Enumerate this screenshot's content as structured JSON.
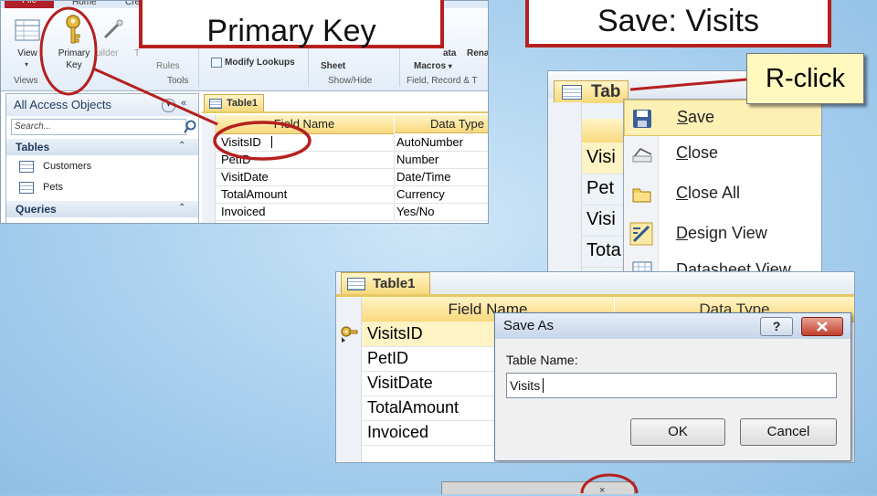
{
  "ribbon": {
    "file_tab": "File",
    "home_tab": "Home",
    "create_tab": "Cre",
    "view_label": "View",
    "primary_key_line1": "Primary",
    "primary_key_line2": "Key",
    "builder_label": "uilder",
    "test_label": "T",
    "rules_label": "Rules",
    "modify_lookups_label": "Modify Lookups",
    "sheet_label": "Sheet",
    "data_label": "ata",
    "rename_label": "Rena",
    "macros_label": "Macros",
    "group_views": "Views",
    "group_tools": "Tools",
    "group_show_hide": "Show/Hide",
    "group_field_record": "Field, Record & T"
  },
  "nav_pane": {
    "title": "All Access Objects",
    "search_placeholder": "Search...",
    "groups": [
      {
        "label": "Tables",
        "items": [
          "Customers",
          "Pets"
        ]
      },
      {
        "label": "Queries",
        "items": []
      }
    ]
  },
  "design_view": {
    "tab_label": "Table1",
    "col_field_name": "Field Name",
    "col_data_type": "Data Type",
    "rows": [
      {
        "field": "VisitsID",
        "type": "AutoNumber"
      },
      {
        "field": "PetID",
        "type": "Number"
      },
      {
        "field": "VisitDate",
        "type": "Date/Time"
      },
      {
        "field": "TotalAmount",
        "type": "Currency"
      },
      {
        "field": "Invoiced",
        "type": "Yes/No"
      }
    ]
  },
  "callouts": {
    "primary_key": "Primary Key",
    "save_visits": "Save: Visits",
    "rclick": "R-click"
  },
  "context_menu": {
    "tab_label": "Tab",
    "peek_rows": [
      "Visi",
      "Pet",
      "Visi",
      "Tota"
    ],
    "items": [
      {
        "label": "Save",
        "underline": "S",
        "rest": "ave",
        "icon": "save-icon"
      },
      {
        "label": "Close",
        "underline": "C",
        "rest": "lose",
        "icon": "close-object-icon"
      },
      {
        "label": "Close All",
        "underline": "C",
        "rest": "lose All",
        "icon": "close-all-icon"
      },
      {
        "label": "Design View",
        "underline": "D",
        "rest": "esign View",
        "icon": "design-view-icon"
      },
      {
        "label": "Datasheet View",
        "pre": "Data",
        "underline": "s",
        "rest": "heet View",
        "icon": "datasheet-view-icon"
      }
    ]
  },
  "save_as": {
    "tab_label": "Table1",
    "col_field_name": "Field Name",
    "col_data_type": "Data Type",
    "rows": [
      "VisitsID",
      "PetID",
      "VisitDate",
      "TotalAmount",
      "Invoiced"
    ],
    "dialog_title": "Save As",
    "help_glyph": "?",
    "table_name_label": "Table Name:",
    "table_name_value": "Visits",
    "ok_label": "OK",
    "cancel_label": "Cancel"
  },
  "colors": {
    "callout_border": "#b5201f",
    "access_red": "#b11f29",
    "header_yellow": "#f9d97d",
    "background_blue": "#a9d0ee"
  }
}
